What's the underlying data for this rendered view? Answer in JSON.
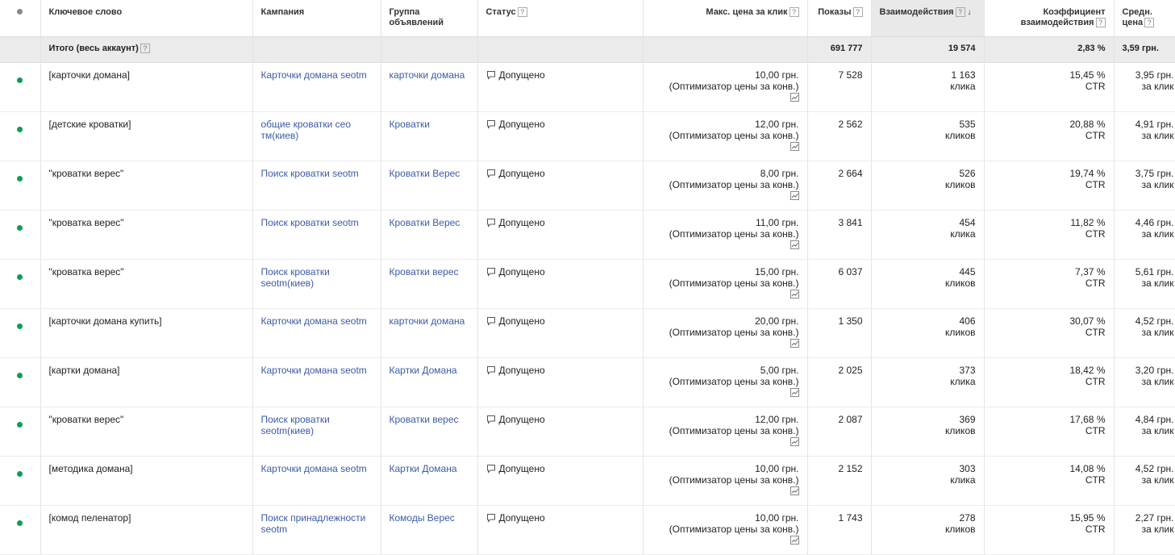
{
  "columns": {
    "keyword": "Ключевое слово",
    "campaign": "Кампания",
    "adgroup": "Группа объявлений",
    "status": "Статус",
    "maxcpc": "Макс. цена за клик",
    "impressions": "Показы",
    "interactions": "Взаимодействия",
    "rate": "Коэффициент взаимодействия",
    "avgcost": "Средн. цена"
  },
  "help_glyph": "?",
  "sort_arrow": "↓",
  "total": {
    "label": "Итого (весь аккаунт)",
    "impressions": "691 777",
    "interactions": "19 574",
    "rate": "2,83 %",
    "avgcost": "3,59 грн."
  },
  "rows": [
    {
      "keyword": "[карточки домана]",
      "campaign": "Карточки домана seotm",
      "adgroup": "карточки домана",
      "status": "Допущено",
      "bid": "10,00 грн.",
      "bid_strategy": "(Оптимизатор цены за конв.)",
      "impressions": "7 528",
      "interactions": "1 163",
      "interactions_unit": "клика",
      "rate": "15,45 %",
      "rate_unit": "CTR",
      "avgcost": "3,95 грн.",
      "avgcost_unit": "за клик"
    },
    {
      "keyword": "[детские кроватки]",
      "campaign": "общие кроватки сео тм(киев)",
      "adgroup": "Кроватки",
      "status": "Допущено",
      "bid": "12,00 грн.",
      "bid_strategy": "(Оптимизатор цены за конв.)",
      "impressions": "2 562",
      "interactions": "535",
      "interactions_unit": "кликов",
      "rate": "20,88 %",
      "rate_unit": "CTR",
      "avgcost": "4,91 грн.",
      "avgcost_unit": "за клик"
    },
    {
      "keyword": "\"кроватки верес\"",
      "campaign": "Поиск кроватки seotm",
      "adgroup": "Кроватки Верес",
      "status": "Допущено",
      "bid": "8,00 грн.",
      "bid_strategy": "(Оптимизатор цены за конв.)",
      "impressions": "2 664",
      "interactions": "526",
      "interactions_unit": "кликов",
      "rate": "19,74 %",
      "rate_unit": "CTR",
      "avgcost": "3,75 грн.",
      "avgcost_unit": "за клик"
    },
    {
      "keyword": "\"кроватка верес\"",
      "campaign": "Поиск кроватки seotm",
      "adgroup": "Кроватки Верес",
      "status": "Допущено",
      "bid": "11,00 грн.",
      "bid_strategy": "(Оптимизатор цены за конв.)",
      "impressions": "3 841",
      "interactions": "454",
      "interactions_unit": "клика",
      "rate": "11,82 %",
      "rate_unit": "CTR",
      "avgcost": "4,46 грн.",
      "avgcost_unit": "за клик"
    },
    {
      "keyword": "\"кроватка верес\"",
      "campaign": "Поиск кроватки seotm(киев)",
      "adgroup": "Кроватки верес",
      "status": "Допущено",
      "bid": "15,00 грн.",
      "bid_strategy": "(Оптимизатор цены за конв.)",
      "impressions": "6 037",
      "interactions": "445",
      "interactions_unit": "кликов",
      "rate": "7,37 %",
      "rate_unit": "CTR",
      "avgcost": "5,61 грн.",
      "avgcost_unit": "за клик"
    },
    {
      "keyword": "[карточки домана купить]",
      "campaign": "Карточки домана seotm",
      "adgroup": "карточки домана",
      "status": "Допущено",
      "bid": "20,00 грн.",
      "bid_strategy": "(Оптимизатор цены за конв.)",
      "impressions": "1 350",
      "interactions": "406",
      "interactions_unit": "кликов",
      "rate": "30,07 %",
      "rate_unit": "CTR",
      "avgcost": "4,52 грн.",
      "avgcost_unit": "за клик"
    },
    {
      "keyword": "[картки домана]",
      "campaign": "Карточки домана seotm",
      "adgroup": "Картки Домана",
      "status": "Допущено",
      "bid": "5,00 грн.",
      "bid_strategy": "(Оптимизатор цены за конв.)",
      "impressions": "2 025",
      "interactions": "373",
      "interactions_unit": "клика",
      "rate": "18,42 %",
      "rate_unit": "CTR",
      "avgcost": "3,20 грн.",
      "avgcost_unit": "за клик"
    },
    {
      "keyword": "\"кроватки верес\"",
      "campaign": "Поиск кроватки seotm(киев)",
      "adgroup": "Кроватки верес",
      "status": "Допущено",
      "bid": "12,00 грн.",
      "bid_strategy": "(Оптимизатор цены за конв.)",
      "impressions": "2 087",
      "interactions": "369",
      "interactions_unit": "кликов",
      "rate": "17,68 %",
      "rate_unit": "CTR",
      "avgcost": "4,84 грн.",
      "avgcost_unit": "за клик"
    },
    {
      "keyword": "[методика домана]",
      "campaign": "Карточки домана seotm",
      "adgroup": "Картки Домана",
      "status": "Допущено",
      "bid": "10,00 грн.",
      "bid_strategy": "(Оптимизатор цены за конв.)",
      "impressions": "2 152",
      "interactions": "303",
      "interactions_unit": "клика",
      "rate": "14,08 %",
      "rate_unit": "CTR",
      "avgcost": "4,52 грн.",
      "avgcost_unit": "за клик"
    },
    {
      "keyword": "[комод пеленатор]",
      "campaign": "Поиск принадлежности seotm",
      "adgroup": "Комоды Верес",
      "status": "Допущено",
      "bid": "10,00 грн.",
      "bid_strategy": "(Оптимизатор цены за конв.)",
      "impressions": "1 743",
      "interactions": "278",
      "interactions_unit": "кликов",
      "rate": "15,95 %",
      "rate_unit": "CTR",
      "avgcost": "2,27 грн.",
      "avgcost_unit": "за клик"
    }
  ],
  "colors": {
    "enabled_dot": "#0f9d58",
    "link": "#3b5aa8",
    "sorted_header_bg": "#e9e9e9",
    "total_row_bg": "#ebebeb"
  }
}
